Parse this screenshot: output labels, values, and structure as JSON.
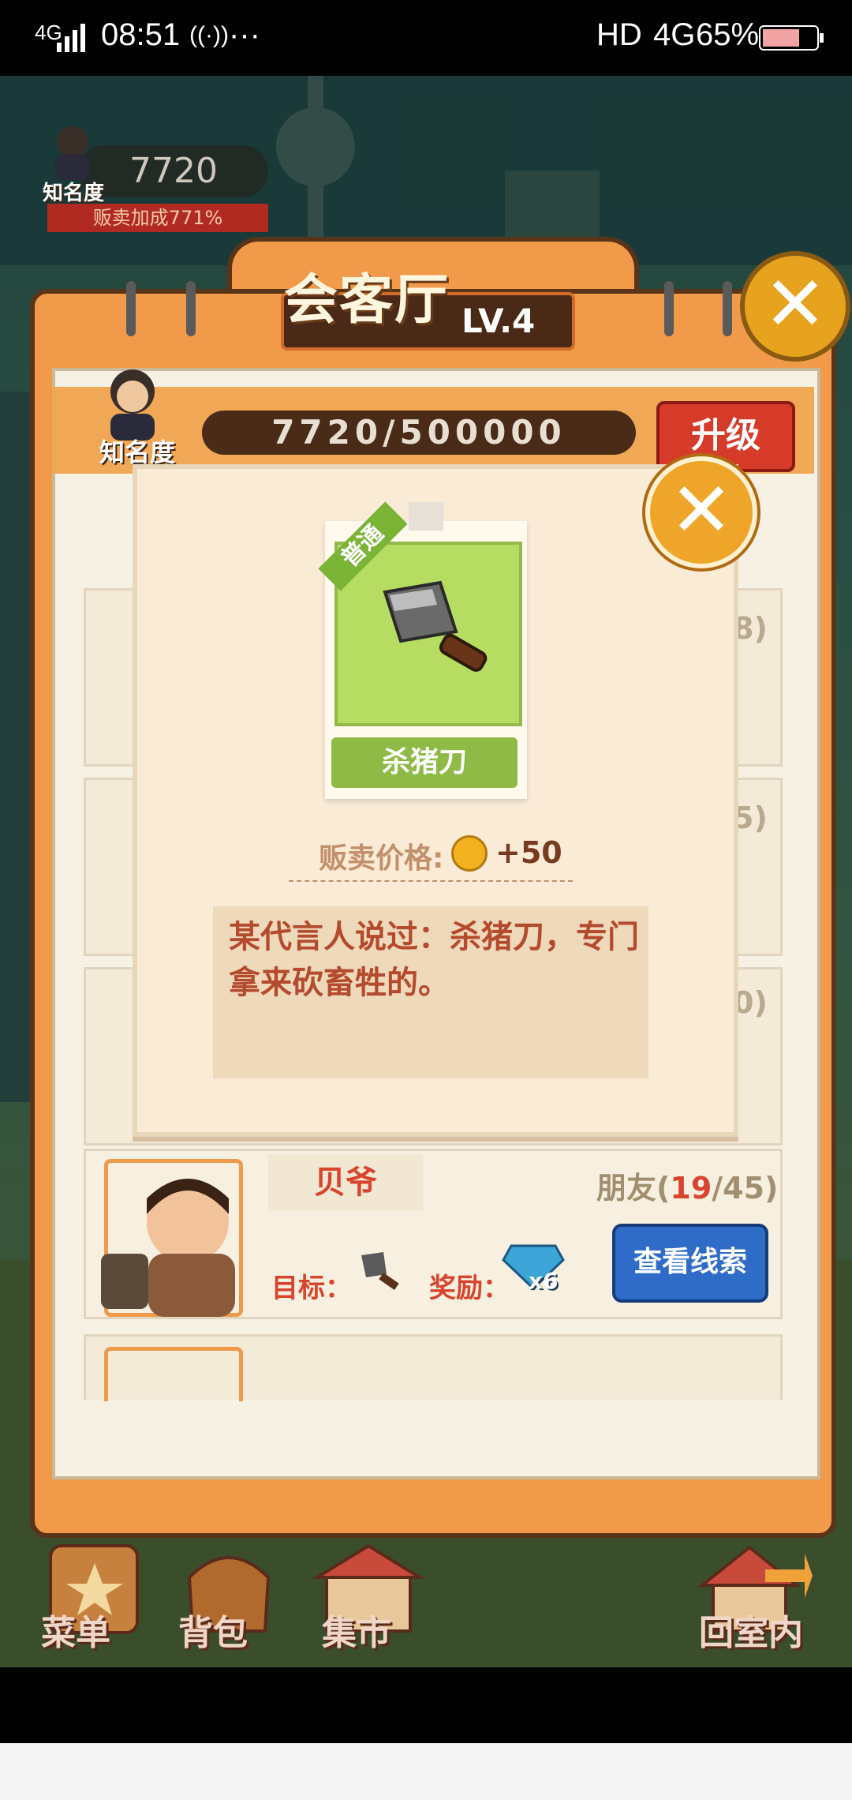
{
  "status_bar": {
    "network": "4G",
    "time": "08:51",
    "hd": "HD",
    "network2": "4G",
    "battery": "65%"
  },
  "hud": {
    "fame_value": "7720",
    "fame_label": "知名度",
    "sale_bonus": "贩卖加成771%"
  },
  "hall": {
    "title": "会客厅",
    "level": "LV.4",
    "fame_label": "知名度",
    "fame_progress": "7720/500000",
    "upgrade_label": "升级",
    "row_counts": [
      "8)",
      "5)",
      "0)"
    ],
    "friend": {
      "name": "贝爷",
      "count_prefix": "朋友(",
      "count_current": "19",
      "count_suffix": "/45)",
      "goal_label": "目标：",
      "reward_label": "奖励：",
      "reward_qty": "x6",
      "clue_button": "查看线索"
    }
  },
  "bottom_menu": [
    {
      "label": "菜单",
      "icon": "book-icon"
    },
    {
      "label": "背包",
      "icon": "bag-icon"
    },
    {
      "label": "集市",
      "icon": "market-icon"
    },
    {
      "label": "回室内",
      "icon": "house-icon"
    }
  ],
  "modal": {
    "rarity": "普通",
    "item_name": "杀猪刀",
    "price_label": "贩卖价格:",
    "price_value": "+50",
    "description": "某代言人说过：杀猪刀，专门拿来砍畜牲的。"
  },
  "colors": {
    "panel_orange": "#f09a4a",
    "modal_bg": "#f9ebd6",
    "accent_red": "#d63b2a",
    "button_blue": "#2e6cc7",
    "item_green": "#b6dc62"
  }
}
